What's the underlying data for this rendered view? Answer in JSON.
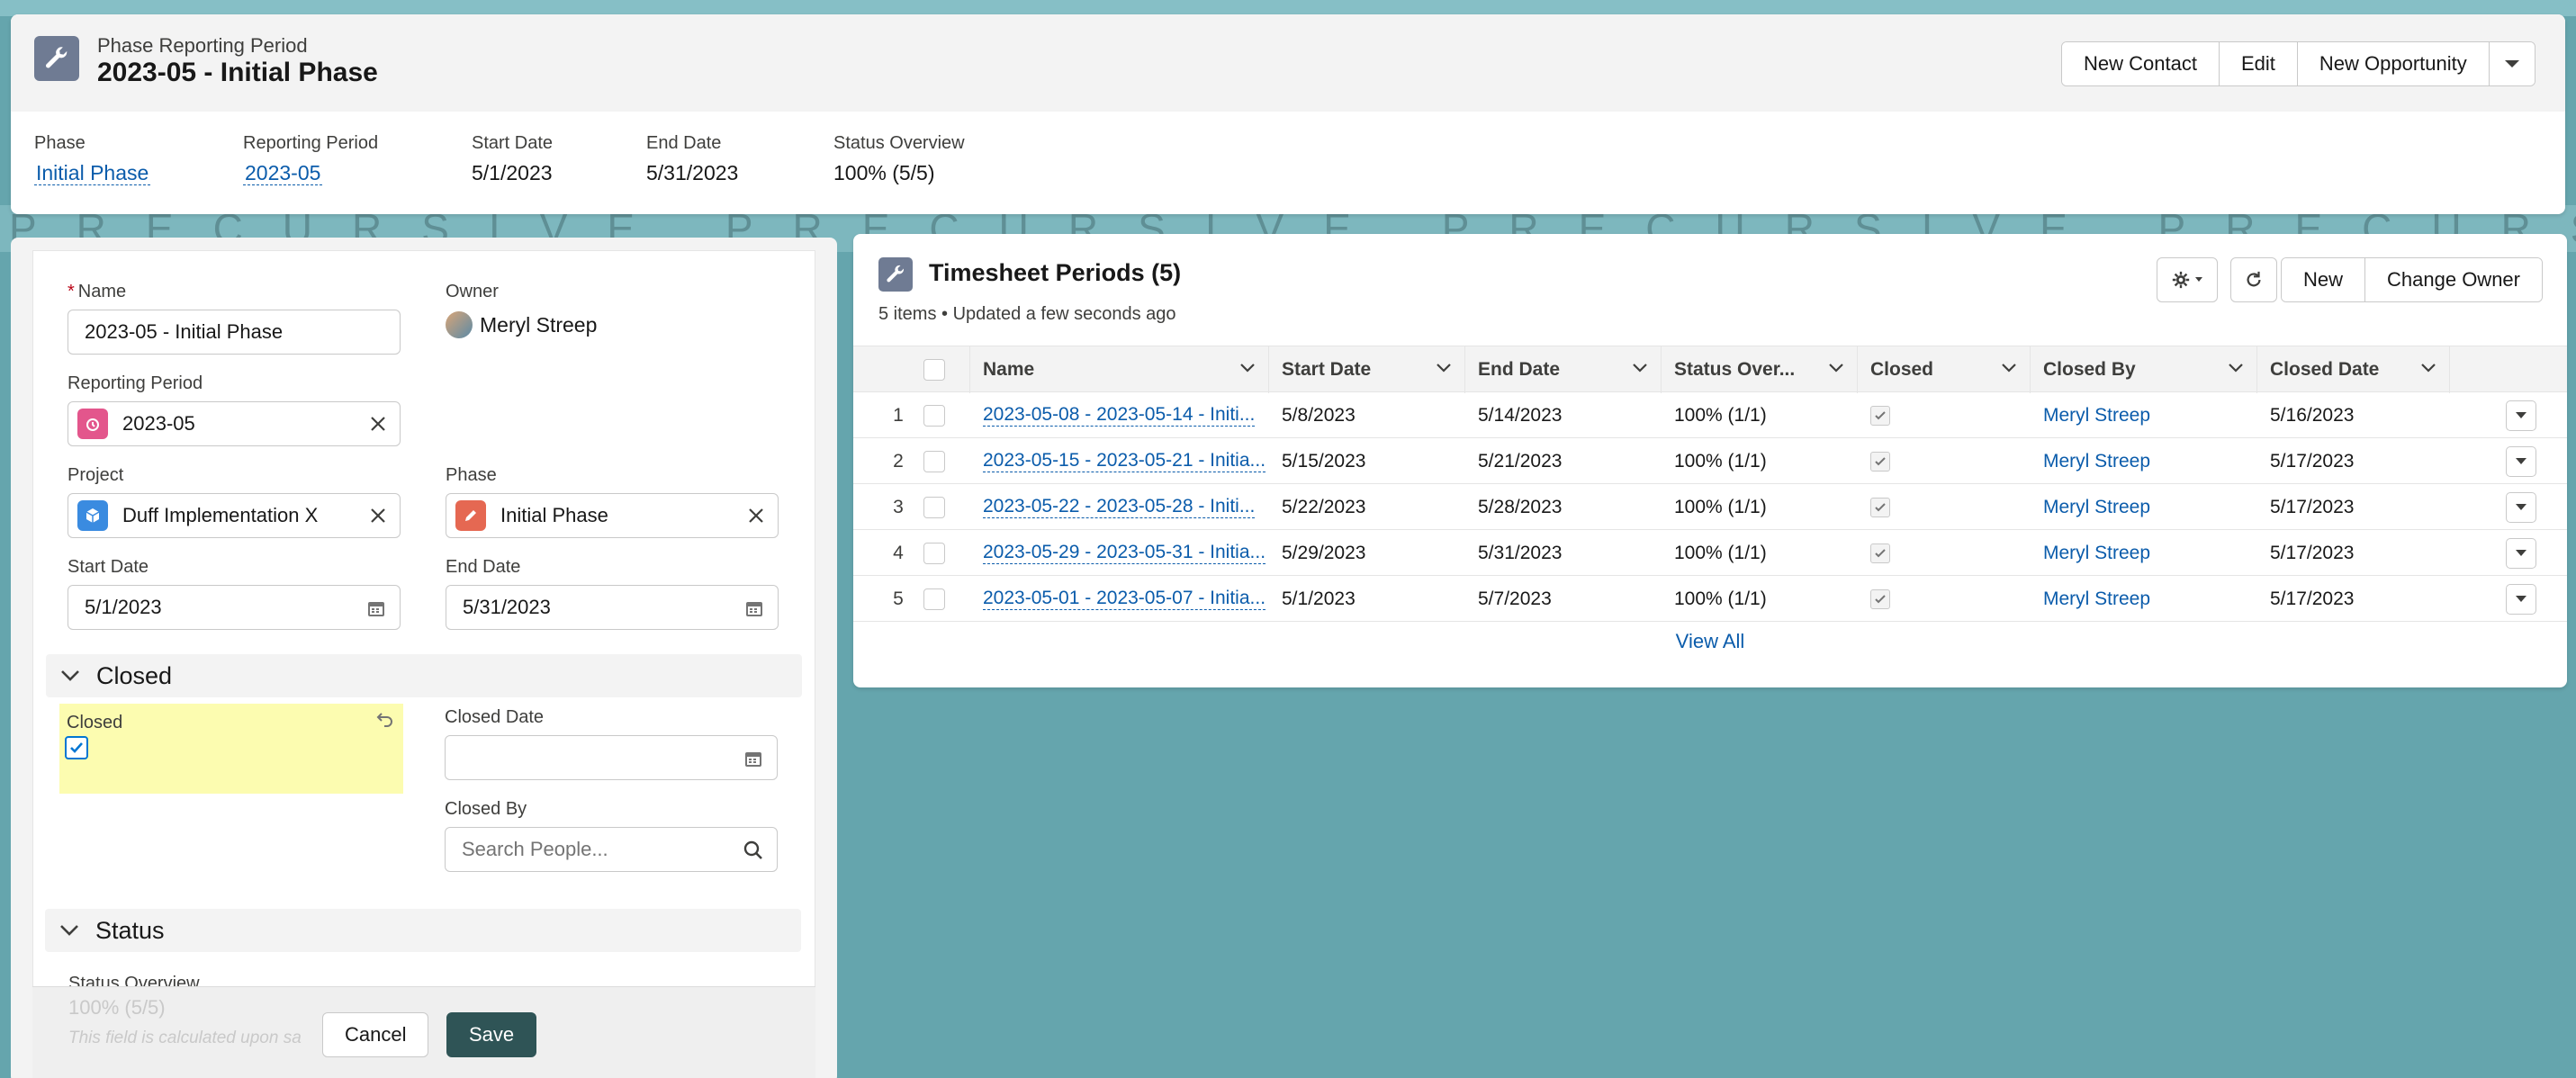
{
  "header": {
    "record_type": "Phase Reporting Period",
    "title": "2023-05 - Initial Phase",
    "actions": [
      "New Contact",
      "Edit",
      "New Opportunity"
    ],
    "fields": [
      {
        "label": "Phase",
        "value": "Initial Phase",
        "link": true
      },
      {
        "label": "Reporting Period",
        "value": "2023-05",
        "link": true
      },
      {
        "label": "Start Date",
        "value": "5/1/2023",
        "link": false
      },
      {
        "label": "End Date",
        "value": "5/31/2023",
        "link": false
      },
      {
        "label": "Status Overview",
        "value": "100% (5/5)",
        "link": false
      }
    ]
  },
  "watermark": "PRECURSIVE PRECURSIVE PRECURSIVE PRECURSIVE",
  "edit_form": {
    "name_label": "Name",
    "name_value": "2023-05 - Initial Phase",
    "owner_label": "Owner",
    "owner_value": "Meryl Streep",
    "reporting_period_label": "Reporting Period",
    "reporting_period_value": "2023-05",
    "project_label": "Project",
    "project_value": "Duff Implementation X",
    "phase_label": "Phase",
    "phase_value": "Initial Phase",
    "start_date_label": "Start Date",
    "start_date_value": "5/1/2023",
    "end_date_label": "End Date",
    "end_date_value": "5/31/2023",
    "closed_section": "Closed",
    "closed_label": "Closed",
    "closed_date_label": "Closed Date",
    "closed_by_label": "Closed By",
    "closed_by_placeholder": "Search People...",
    "status_section": "Status",
    "status_overview_label": "Status Overview",
    "status_overview_value": "100% (5/5)",
    "status_help": "This field is calculated upon sa",
    "cancel_label": "Cancel",
    "save_label": "Save"
  },
  "timesheet": {
    "title": "Timesheet Periods (5)",
    "subtitle": "5 items • Updated a few seconds ago",
    "new_label": "New",
    "change_owner_label": "Change Owner",
    "columns": [
      "Name",
      "Start Date",
      "End Date",
      "Status Over...",
      "Closed",
      "Closed By",
      "Closed Date"
    ],
    "rows": [
      {
        "num": "1",
        "name": "2023-05-08 - 2023-05-14 - Initi...",
        "start": "5/8/2023",
        "end": "5/14/2023",
        "status": "100% (1/1)",
        "closed_by": "Meryl Streep",
        "closed_date": "5/16/2023"
      },
      {
        "num": "2",
        "name": "2023-05-15 - 2023-05-21 - Initia...",
        "start": "5/15/2023",
        "end": "5/21/2023",
        "status": "100% (1/1)",
        "closed_by": "Meryl Streep",
        "closed_date": "5/17/2023"
      },
      {
        "num": "3",
        "name": "2023-05-22 - 2023-05-28 - Initi...",
        "start": "5/22/2023",
        "end": "5/28/2023",
        "status": "100% (1/1)",
        "closed_by": "Meryl Streep",
        "closed_date": "5/17/2023"
      },
      {
        "num": "4",
        "name": "2023-05-29 - 2023-05-31 - Initia...",
        "start": "5/29/2023",
        "end": "5/31/2023",
        "status": "100% (1/1)",
        "closed_by": "Meryl Streep",
        "closed_date": "5/17/2023"
      },
      {
        "num": "5",
        "name": "2023-05-01 - 2023-05-07 - Initia...",
        "start": "5/1/2023",
        "end": "5/7/2023",
        "status": "100% (1/1)",
        "closed_by": "Meryl Streep",
        "closed_date": "5/17/2023"
      }
    ],
    "view_all": "View All"
  },
  "colors": {
    "brand": "#0176d3",
    "link": "#0b5cab",
    "save": "#2f5456",
    "background": "#65a5ad"
  }
}
